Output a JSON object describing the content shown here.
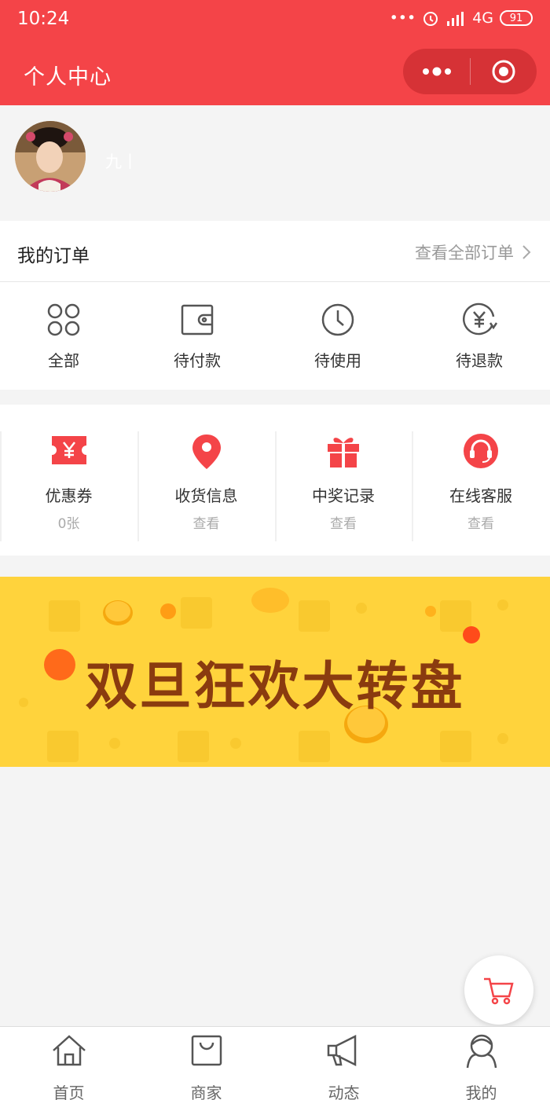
{
  "status": {
    "time": "10:24",
    "network": "4G",
    "battery": "91"
  },
  "nav": {
    "title": "个人中心",
    "more_icon": "more-dots-icon",
    "close_icon": "target-circle-icon"
  },
  "profile": {
    "username": "九丨"
  },
  "orders": {
    "title": "我的订单",
    "view_all": "查看全部订单",
    "items": [
      {
        "label": "全部",
        "icon": "four-petal-grid-icon"
      },
      {
        "label": "待付款",
        "icon": "wallet-icon"
      },
      {
        "label": "待使用",
        "icon": "clock-icon"
      },
      {
        "label": "待退款",
        "icon": "yen-refund-icon"
      }
    ]
  },
  "services": [
    {
      "name": "优惠券",
      "sub": "0张",
      "icon": "coupon-yen-icon"
    },
    {
      "name": "收货信息",
      "sub": "查看",
      "icon": "location-pin-icon"
    },
    {
      "name": "中奖记录",
      "sub": "查看",
      "icon": "gift-icon"
    },
    {
      "name": "在线客服",
      "sub": "查看",
      "icon": "headset-icon"
    }
  ],
  "banner": {
    "text": "双旦狂欢大转盘"
  },
  "tabbar": [
    {
      "label": "首页",
      "icon": "home-icon"
    },
    {
      "label": "商家",
      "icon": "shopping-bag-icon"
    },
    {
      "label": "动态",
      "icon": "megaphone-icon"
    },
    {
      "label": "我的",
      "icon": "user-icon"
    }
  ],
  "colors": {
    "brand_red": "#f44448",
    "banner_yellow": "#ffd33c",
    "banner_text": "#8a3b0f"
  }
}
